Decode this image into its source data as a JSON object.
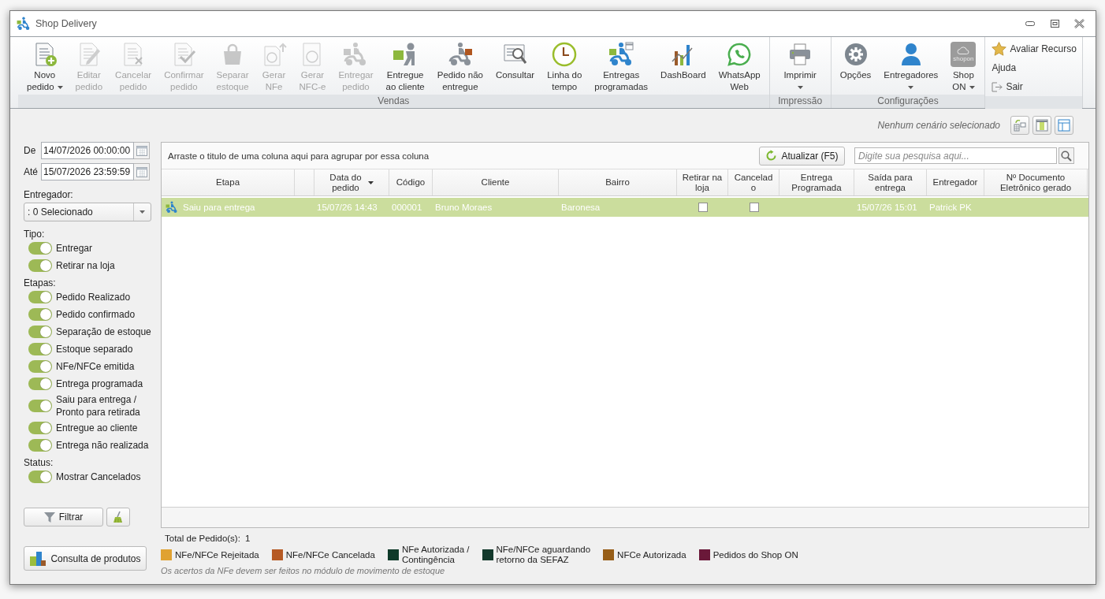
{
  "window": {
    "title": "Shop Delivery"
  },
  "ribbon": {
    "groups": [
      {
        "label": "Vendas",
        "buttons": [
          {
            "label": "Novo\npedido",
            "disabled": false,
            "has_menu": true
          },
          {
            "label": "Editar\npedido",
            "disabled": true,
            "has_menu": false
          },
          {
            "label": "Cancelar\npedido",
            "disabled": true,
            "has_menu": false
          },
          {
            "label": "Confirmar\npedido",
            "disabled": true,
            "has_menu": false
          },
          {
            "label": "Separar\nestoque",
            "disabled": true,
            "has_menu": false
          },
          {
            "label": "Gerar\nNFe",
            "disabled": true,
            "has_menu": false
          },
          {
            "label": "Gerar\nNFC-e",
            "disabled": true,
            "has_menu": false
          },
          {
            "label": "Entregar\npedido",
            "disabled": true,
            "has_menu": false
          },
          {
            "label": "Entregue\nao cliente",
            "disabled": false,
            "has_menu": false
          },
          {
            "label": "Pedido não\nentregue",
            "disabled": false,
            "has_menu": false
          },
          {
            "label": "Consultar",
            "disabled": false,
            "has_menu": false
          },
          {
            "label": "Linha do\ntempo",
            "disabled": false,
            "has_menu": false
          },
          {
            "label": "Entregas\nprogramadas",
            "disabled": false,
            "has_menu": false
          },
          {
            "label": "DashBoard",
            "disabled": false,
            "has_menu": false
          },
          {
            "label": "WhatsApp\nWeb",
            "disabled": false,
            "has_menu": false
          }
        ]
      },
      {
        "label": "Impressão",
        "buttons": [
          {
            "label": "Imprimir",
            "disabled": false,
            "has_menu": true
          }
        ]
      },
      {
        "label": "Configurações",
        "buttons": [
          {
            "label": "Opções",
            "disabled": false,
            "has_menu": false
          },
          {
            "label": "Entregadores",
            "disabled": false,
            "has_menu": true
          },
          {
            "label": "Shop\nON",
            "disabled": false,
            "has_menu": true,
            "logo_text": "shopon"
          }
        ]
      }
    ],
    "side_links": [
      {
        "label": "Avaliar Recurso"
      },
      {
        "label": "Ajuda"
      },
      {
        "label": "Sair"
      }
    ]
  },
  "scenario": {
    "text": "Nenhum cenário selecionado"
  },
  "filters": {
    "date_from": {
      "label": "De",
      "value": "14/07/2026 00:00:00"
    },
    "date_to": {
      "label": "Até",
      "value": "15/07/2026 23:59:59"
    },
    "courier": {
      "label": "Entregador:",
      "value": ": 0 Selecionado"
    },
    "sections": [
      {
        "title": "Tipo:",
        "toggles": [
          {
            "label": "Entregar",
            "on": true
          },
          {
            "label": "Retirar na loja",
            "on": true
          }
        ]
      },
      {
        "title": "Etapas:",
        "toggles": [
          {
            "label": "Pedido Realizado",
            "on": true
          },
          {
            "label": "Pedido confirmado",
            "on": true
          },
          {
            "label": "Separação de estoque",
            "on": true
          },
          {
            "label": "Estoque separado",
            "on": true
          },
          {
            "label": "NFe/NFCe emitida",
            "on": true
          },
          {
            "label": "Entrega programada",
            "on": true
          },
          {
            "label": "Saiu para entrega /\nPronto para retirada",
            "on": true
          },
          {
            "label": "Entregue ao cliente",
            "on": true
          },
          {
            "label": "Entrega não realizada",
            "on": true
          }
        ]
      },
      {
        "title": "Status:",
        "toggles": [
          {
            "label": "Mostrar Cancelados",
            "on": true
          }
        ]
      }
    ],
    "filter_button": "Filtrar"
  },
  "product_lookup_button": "Consulta de produtos",
  "grid": {
    "group_hint": "Arraste o titulo de uma coluna aqui para agrupar por essa coluna",
    "refresh_button": "Atualizar (F5)",
    "search": {
      "placeholder": "Digite sua pesquisa aqui..."
    },
    "columns": [
      {
        "label": "Etapa",
        "sorted": false
      },
      {
        "label": "Data do\npedido",
        "sorted": true
      },
      {
        "label": "Código",
        "sorted": false
      },
      {
        "label": "Cliente",
        "sorted": false
      },
      {
        "label": "Bairro",
        "sorted": false
      },
      {
        "label": "Retirar na\nloja",
        "sorted": false
      },
      {
        "label": "Cancelado",
        "sorted": false
      },
      {
        "label": "Entrega\nProgramada",
        "sorted": false
      },
      {
        "label": "Saída para\nentrega",
        "sorted": false
      },
      {
        "label": "Entregador",
        "sorted": false
      },
      {
        "label": "Nº Documento\nEletrônico gerado",
        "sorted": false
      }
    ],
    "rows": [
      {
        "selected": true,
        "etapa": "Saiu para entrega",
        "data_do_pedido": "15/07/26 14:43",
        "codigo": "000001",
        "cliente": "Bruno Moraes",
        "bairro": "Baronesa",
        "retirar_na_loja": false,
        "cancelado": false,
        "saida_para_entrega": "15/07/26 15:01",
        "entregador": "Patrick PK"
      }
    ]
  },
  "summary": {
    "label": "Total de Pedido(s):",
    "value": "1"
  },
  "legend": [
    {
      "label": "NFe/NFCe Rejeitada",
      "color": "#e0a232"
    },
    {
      "label": "NFe/NFCe Cancelada",
      "color": "#b65a24"
    },
    {
      "label": "NFe Autorizada /\nContingência",
      "color": "#0e3a29"
    },
    {
      "label": "NFe/NFCe aguardando\nretorno da SEFAZ",
      "color": "#13392c"
    },
    {
      "label": "NFCe Autorizada",
      "color": "#975e18"
    },
    {
      "label": "Pedidos do Shop ON",
      "color": "#6a1839"
    }
  ],
  "note": "Os acertos da NFe devem ser feitos no módulo de movimento de estoque"
}
